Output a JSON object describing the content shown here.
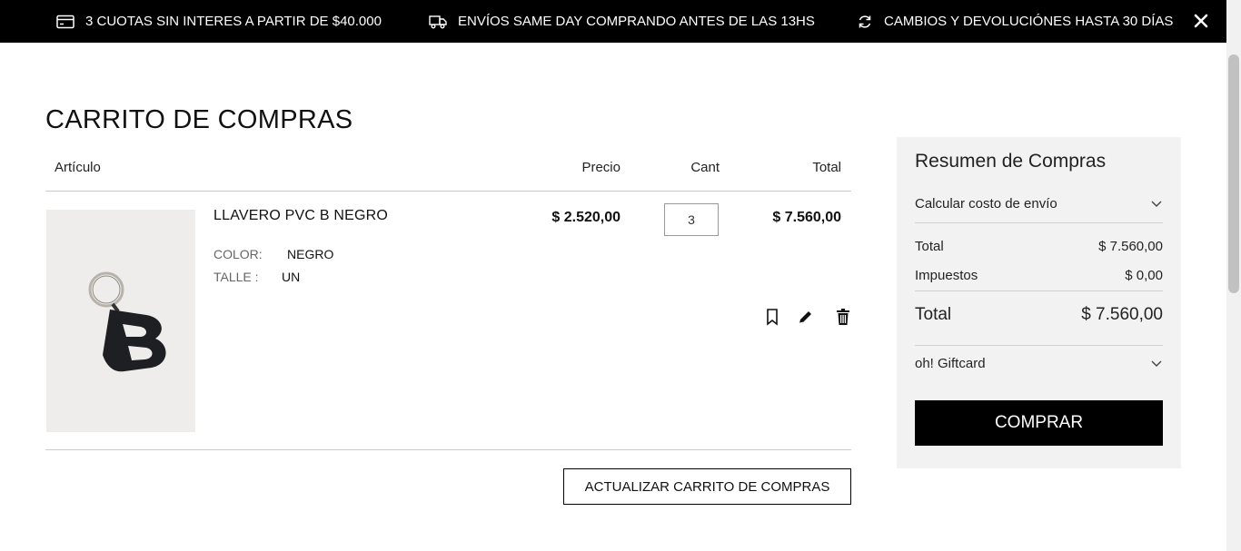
{
  "topbar": {
    "promo1": "3 CUOTAS SIN INTERES A PARTIR DE $40.000",
    "promo1_icon": "credit-card-icon",
    "promo2": "ENVÍOS SAME DAY COMPRANDO ANTES DE LAS 13HS",
    "promo2_icon": "truck-icon",
    "promo3": "CAMBIOS Y DEVOLUCIÓNES HASTA 30 DÍAS",
    "promo3_icon": "refresh-icon",
    "close_icon": "close-icon"
  },
  "cart": {
    "title": "CARRITO DE COMPRAS",
    "headers": {
      "article": "Artículo",
      "price": "Precio",
      "qty": "Cant",
      "total": "Total"
    },
    "items": [
      {
        "name": "LLAVERO PVC B NEGRO",
        "color_label": "COLOR:",
        "color_value": "NEGRO",
        "size_label": "TALLE :",
        "size_value": "UN",
        "price": "$ 2.520,00",
        "qty": "3",
        "total": "$ 7.560,00",
        "actions": [
          "bookmark-icon",
          "edit-icon",
          "trash-icon"
        ]
      }
    ],
    "update_label": "ACTUALIZAR CARRITO DE COMPRAS"
  },
  "summary": {
    "title": "Resumen de Compras",
    "shipping_label": "Calcular costo de envío",
    "subtotal_label": "Total",
    "subtotal_value": "$ 7.560,00",
    "tax_label": "Impuestos",
    "tax_value": "$ 0,00",
    "grand_label": "Total",
    "grand_value": "$ 7.560,00",
    "giftcard_label": "oh! Giftcard",
    "buy_label": "COMPRAR"
  },
  "colors": {
    "topbar_bg": "#000000",
    "summary_bg": "#f2f2f2",
    "buy_bg": "#000000"
  }
}
